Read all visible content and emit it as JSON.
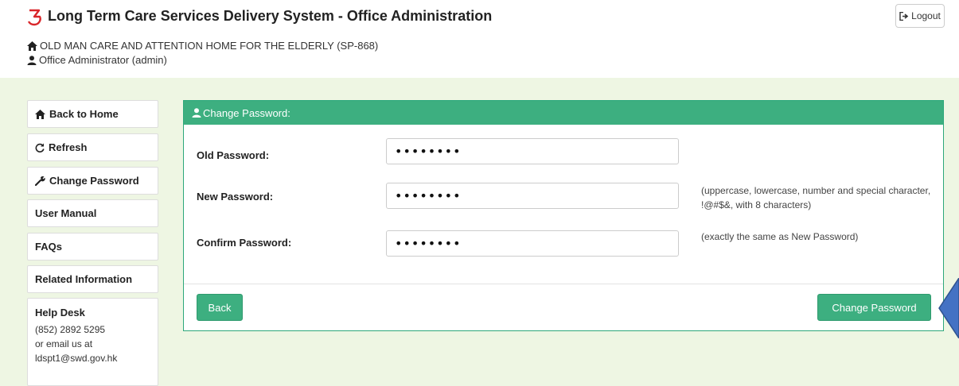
{
  "header": {
    "title": "Long Term Care Services Delivery System - Office Administration",
    "organization": "OLD MAN CARE AND ATTENTION HOME FOR THE ELDERLY (SP-868)",
    "user": "Office Administrator (admin)",
    "logout_label": "Logout"
  },
  "sidebar": {
    "items": [
      {
        "label": "Back to Home",
        "icon": "home-icon"
      },
      {
        "label": "Refresh",
        "icon": "refresh-icon"
      },
      {
        "label": "Change Password",
        "icon": "wrench-icon"
      },
      {
        "label": "User Manual"
      },
      {
        "label": "FAQs"
      },
      {
        "label": "Related Information"
      }
    ],
    "helpdesk": {
      "title": "Help Desk",
      "phone": "(852) 2892 5295",
      "email_prefix": "or email us at",
      "email": "ldspt1@swd.gov.hk"
    }
  },
  "form": {
    "heading": "Change Password:",
    "old_password": {
      "label": "Old Password:",
      "value": "••••••••"
    },
    "new_password": {
      "label": "New Password:",
      "value": "••••••••",
      "hint": "(uppercase, lowercase, number and special character, !@#$&, with 8 characters)"
    },
    "confirm_password": {
      "label": "Confirm Password:",
      "value": "••••••••",
      "hint": "(exactly the same as New Password)"
    },
    "back_label": "Back",
    "submit_label": "Change Password"
  },
  "colors": {
    "accent_green": "#3daf80",
    "content_bg": "#eef6e3",
    "logo_red": "#d9262a",
    "pointer_blue": "#4472c4"
  }
}
